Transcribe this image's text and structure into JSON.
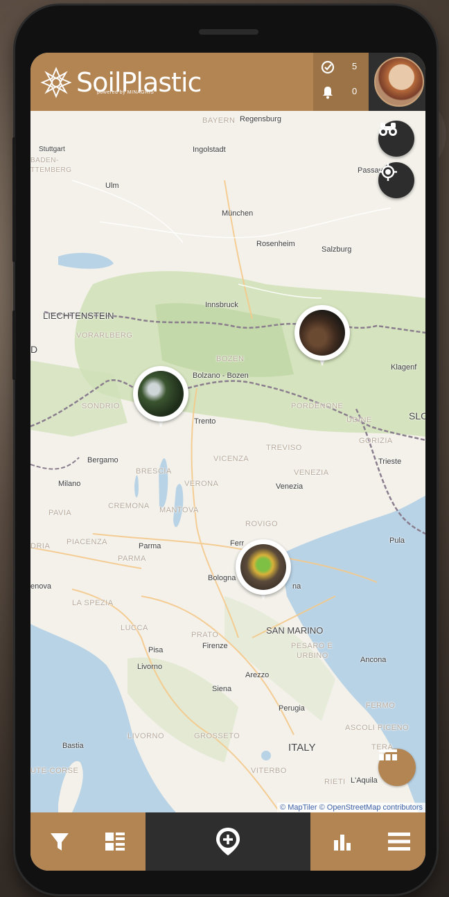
{
  "app": {
    "name": "SoilPlastic",
    "powered_by": "powered by MINAGRIS"
  },
  "header": {
    "checks_count": "5",
    "notifications_count": "0"
  },
  "map": {
    "labels": {
      "bayern": "BAYERN",
      "regensburg": "Regensburg",
      "stuttgart": "Stuttgart",
      "baden": "BADEN-",
      "wurttemberg": "TTEMBERG",
      "ingolstadt": "Ingolstadt",
      "passau": "Passau",
      "ulm": "Ulm",
      "munchen": "München",
      "rosenheim": "Rosenheim",
      "salzburg": "Salzburg",
      "innsbruck": "Innsbruck",
      "liechtenstein": "LIECHTENSTEIN",
      "vorarlberg": "VORARLBERG",
      "d": "D",
      "bozen": "BOZEN",
      "bolzano": "Bolzano - Bozen",
      "klagenfurt": "Klagenf",
      "sondrio": "SONDRIO",
      "trento": "Trento",
      "pordenone": "PORDENONE",
      "udine": "UDINE",
      "slo": "SLO",
      "gorizia": "GORIZIA",
      "treviso": "TREVISO",
      "bergamo": "Bergamo",
      "vicenza": "VICENZA",
      "trieste": "Trieste",
      "brescia": "BRESCIA",
      "venezia": "VENEZIA",
      "milano": "Milano",
      "verona": "VERONA",
      "venezia_city": "Venezia",
      "pavia": "PAVIA",
      "cremona": "CREMONA",
      "mantova": "MANTOVA",
      "rovigo": "ROVIGO",
      "piacenza": "PIACENZA",
      "dria": "DRIA",
      "parma_city": "Parma",
      "parma": "PARMA",
      "ferrara": "Ferr",
      "pula": "Pula",
      "bologna": "Bologna",
      "enova": "enova",
      "na": "na",
      "la_spezia": "LA SPEZIA",
      "lucca": "LUCCA",
      "prato": "PRATO",
      "san_marino": "SAN MARINO",
      "pisa": "Pisa",
      "firenze": "Firenze",
      "pesaro": "PESARO E",
      "urbino": "URBINO",
      "livorno": "Livorno",
      "ancona": "Ancona",
      "siena": "Siena",
      "arezzo": "Arezzo",
      "fermo": "FERMO",
      "perugia": "Perugia",
      "ascoli": "ASCOLI PICENO",
      "bastia": "Bastia",
      "livorno_prov": "LIVORNO",
      "grosseto": "GROSSETO",
      "italy": "ITALY",
      "tera": "TERA",
      "corse": "UTE-CORSE",
      "viterbo": "VITERBO",
      "rieti": "RIETI",
      "aquila": "L'Aquila"
    },
    "attribution": "© MapTiler © OpenStreetMap contributors"
  },
  "icons": {
    "check": "check-circle-icon",
    "bell": "bell-icon",
    "search": "binoculars-icon",
    "locate": "crosshair-icon",
    "timeline": "timeline-icon",
    "filter": "filter-icon",
    "list": "list-view-icon",
    "add": "add-location-icon",
    "stats": "bar-chart-icon",
    "menu": "menu-icon"
  },
  "colors": {
    "brand": "#b38553",
    "dark": "#2e2e2e",
    "water": "#b9d3e6",
    "land": "#f2efe7",
    "forest": "#c9dcb0"
  }
}
